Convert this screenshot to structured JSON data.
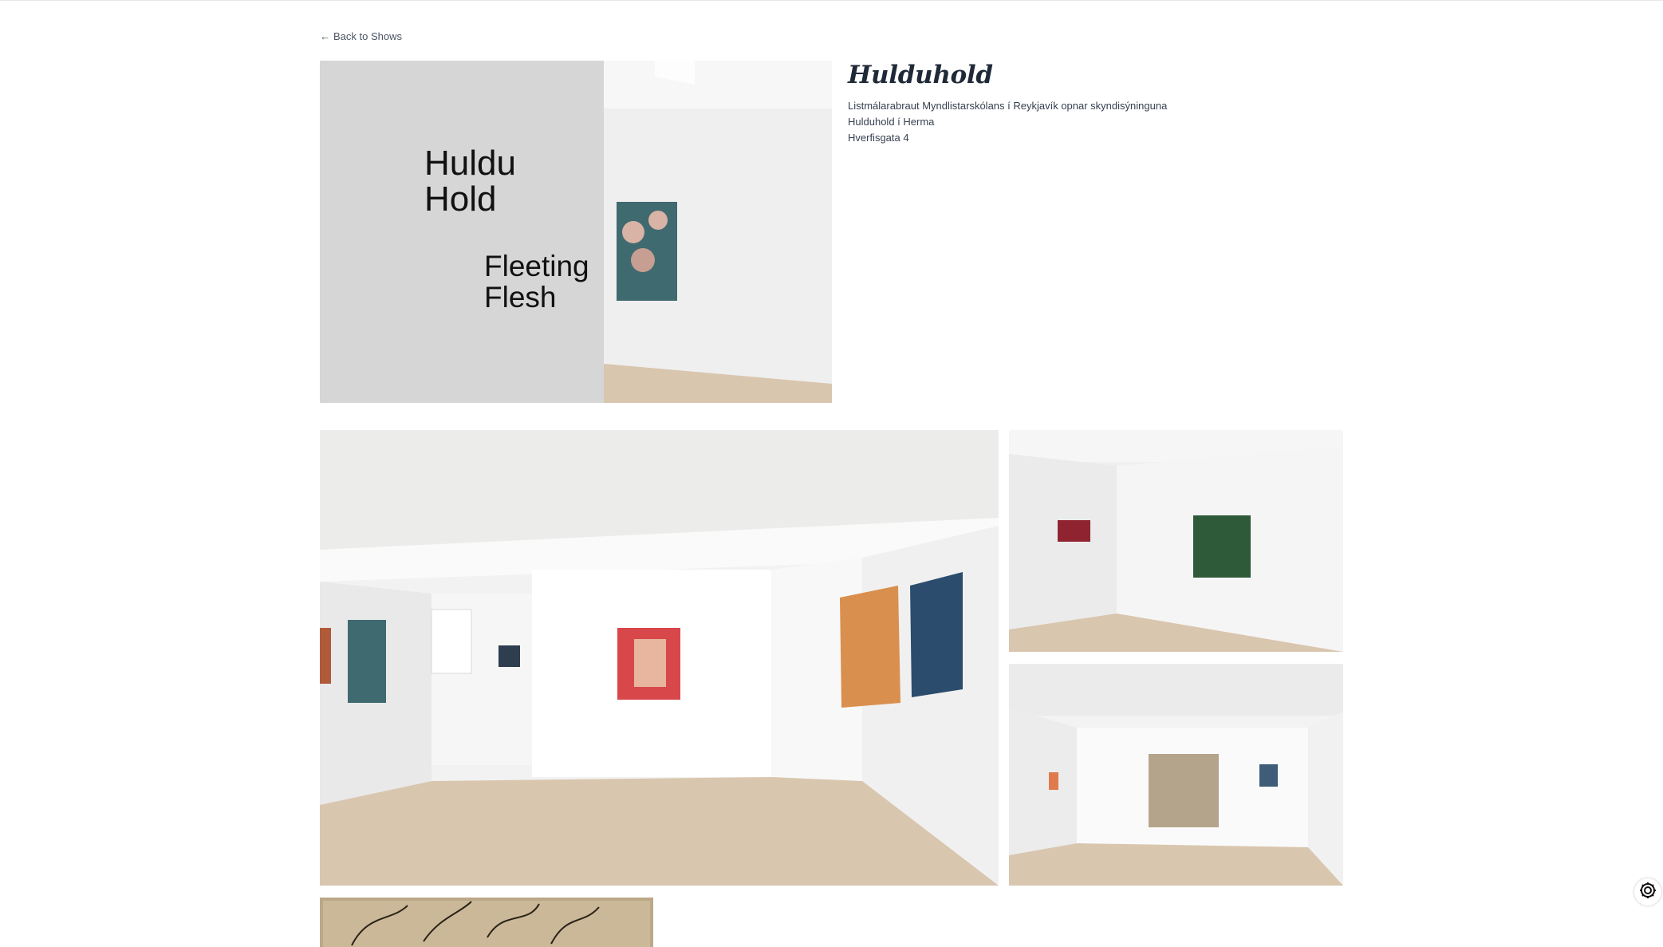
{
  "nav": {
    "back_label": "Back to Shows",
    "back_icon": "arrow-left-icon"
  },
  "show": {
    "title": "Hulduhold",
    "description": "Listmálarabraut Myndlistarskólans í Reykjavík opnar skyndisýninguna",
    "subtitle": "Hulduhold í Herma",
    "address": "Hverfisgata 4"
  },
  "hero_wall_text": [
    "Huldu",
    "Hold",
    "Fleeting",
    "Flesh"
  ],
  "gallery": {
    "images": [
      {
        "name": "gallery-photo-wide"
      },
      {
        "name": "gallery-photo-corner"
      },
      {
        "name": "gallery-photo-room"
      },
      {
        "name": "gallery-photo-drawing"
      }
    ]
  },
  "widget": {
    "icon": "gear-icon"
  },
  "colors": {
    "text": "#1f2937",
    "muted": "#4b5563",
    "wall": "#f4f4f2",
    "floor": "#d9c6ae"
  }
}
